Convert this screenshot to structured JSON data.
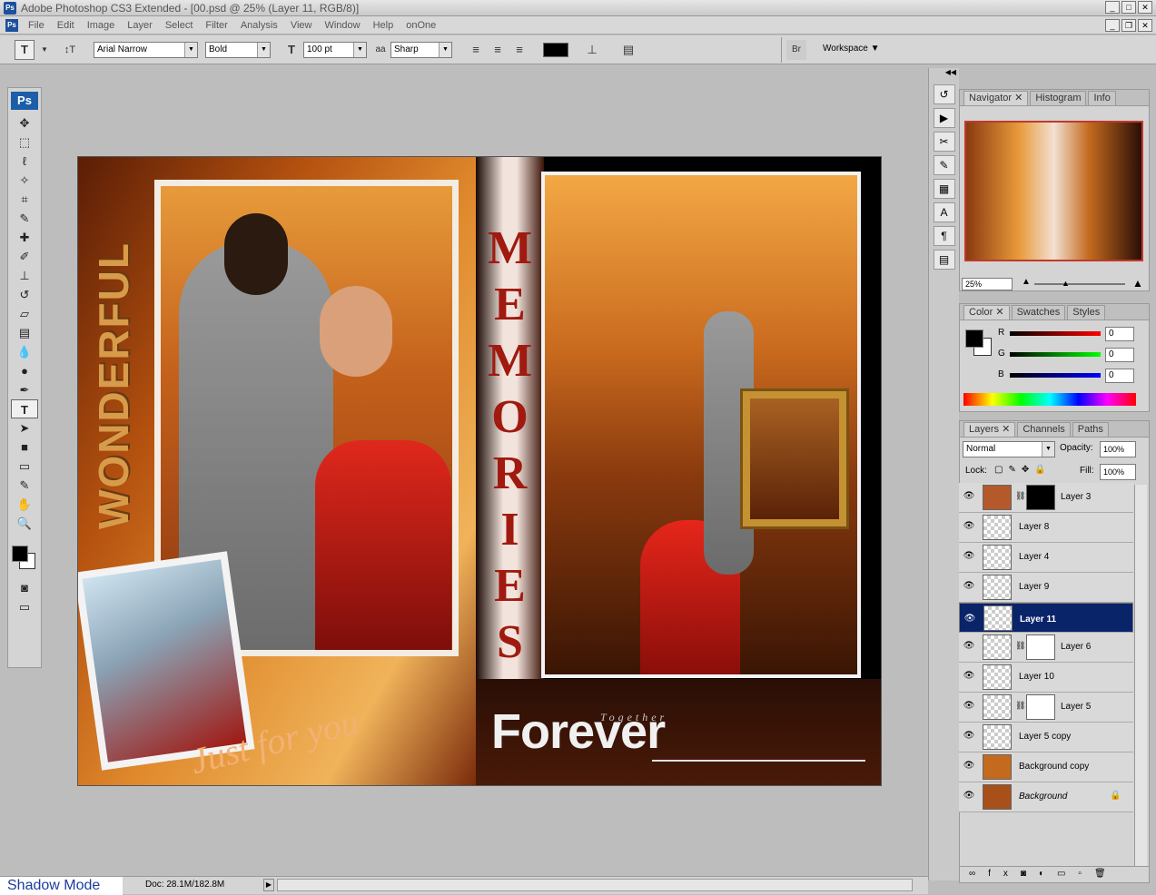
{
  "titlebar": {
    "title": "Adobe Photoshop CS3 Extended - [00.psd @ 25% (Layer 11, RGB/8)]",
    "ps_logo": "Ps"
  },
  "menubar": {
    "items": [
      "File",
      "Edit",
      "Image",
      "Layer",
      "Select",
      "Filter",
      "Analysis",
      "View",
      "Window",
      "Help",
      "onOne"
    ]
  },
  "options": {
    "tool_icon": "T",
    "font_family": "Arial Narrow",
    "font_style": "Bold",
    "font_size": "100 pt",
    "aa_icon": "aa",
    "antialias": "Sharp",
    "text_color": "#000000",
    "workspace_label": "Workspace"
  },
  "toolbox": {
    "logo": "Ps"
  },
  "document": {
    "wonderful": "WONDERFUL",
    "memories": [
      "M",
      "E",
      "M",
      "O",
      "R",
      "I",
      "E",
      "S"
    ],
    "just_for_you": "Just for you",
    "together": "Together",
    "forever": "Forever"
  },
  "navigator": {
    "tabs": [
      "Navigator",
      "Histogram",
      "Info"
    ],
    "zoom": "25%"
  },
  "color": {
    "tabs": [
      "Color",
      "Swatches",
      "Styles"
    ],
    "r_label": "R",
    "g_label": "G",
    "b_label": "B",
    "r": "0",
    "g": "0",
    "b": "0"
  },
  "layers": {
    "tabs": [
      "Layers",
      "Channels",
      "Paths"
    ],
    "blend": "Normal",
    "opacity_label": "Opacity:",
    "opacity": "100%",
    "lock_label": "Lock:",
    "fill_label": "Fill:",
    "fill": "100%",
    "items": [
      {
        "name": "Layer 3"
      },
      {
        "name": "Layer 8"
      },
      {
        "name": "Layer 4"
      },
      {
        "name": "Layer 9"
      },
      {
        "name": "Layer 11"
      },
      {
        "name": "Layer 6"
      },
      {
        "name": "Layer 10"
      },
      {
        "name": "Layer 5"
      },
      {
        "name": "Layer 5 copy"
      },
      {
        "name": "Background copy"
      },
      {
        "name": "Background"
      }
    ]
  },
  "status": {
    "shadow_mode": "Shadow Mode",
    "doc": "Doc: 28.1M/182.8M"
  }
}
